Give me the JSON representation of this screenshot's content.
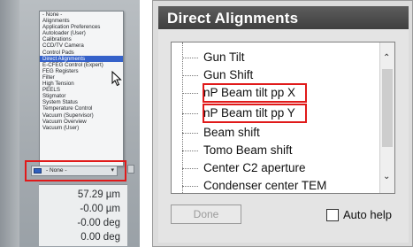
{
  "dropdown": {
    "items": [
      {
        "label": "- None -"
      },
      {
        "label": "Alignments"
      },
      {
        "label": "Application Preferences"
      },
      {
        "label": "Autoloader (User)"
      },
      {
        "label": "Calibrations"
      },
      {
        "label": "CCD/TV Camera"
      },
      {
        "label": "Control Pads"
      },
      {
        "label": "Direct Alignments"
      },
      {
        "label": "E-CFEG Control (Expert)"
      },
      {
        "label": "FEG Registers"
      },
      {
        "label": "Filter"
      },
      {
        "label": "High Tension"
      },
      {
        "label": "PEELS"
      },
      {
        "label": "Stigmator"
      },
      {
        "label": "System Status"
      },
      {
        "label": "Temperature Control"
      },
      {
        "label": "Vacuum (Supervisor)"
      },
      {
        "label": "Vacuum Overview"
      },
      {
        "label": "Vacuum (User)"
      }
    ],
    "selected_index": 7,
    "highlight_color": "#3561c9",
    "current_value": "- None -"
  },
  "readouts": [
    {
      "value": "57.29 µm"
    },
    {
      "value": "-0.00 µm"
    },
    {
      "value": "-0.00 deg"
    },
    {
      "value": "0.00 deg"
    }
  ],
  "dialog": {
    "title": "Direct Alignments",
    "tree_items": [
      {
        "label": "Gun Tilt",
        "highlighted": false
      },
      {
        "label": "Gun Shift",
        "highlighted": false
      },
      {
        "label": "nP Beam tilt pp X",
        "highlighted": true
      },
      {
        "label": "nP Beam tilt pp Y",
        "highlighted": true
      },
      {
        "label": "Beam shift",
        "highlighted": false
      },
      {
        "label": "Tomo Beam shift",
        "highlighted": false
      },
      {
        "label": "Center C2 aperture",
        "highlighted": false
      },
      {
        "label": "Condenser center TEM",
        "highlighted": false
      }
    ],
    "done_label": "Done",
    "autohelp_label": "Auto help",
    "autohelp_checked": false
  },
  "icons": {
    "scroll_up": "chevron-up-icon",
    "scroll_down": "chevron-down-icon",
    "cursor": "mouse-pointer-icon",
    "select_chevron": "chevron-down-icon"
  },
  "colors": {
    "annotation_red": "#e01a1a",
    "title_bar": "#4a4a4a",
    "dialog_bg": "#e4e4e4"
  }
}
